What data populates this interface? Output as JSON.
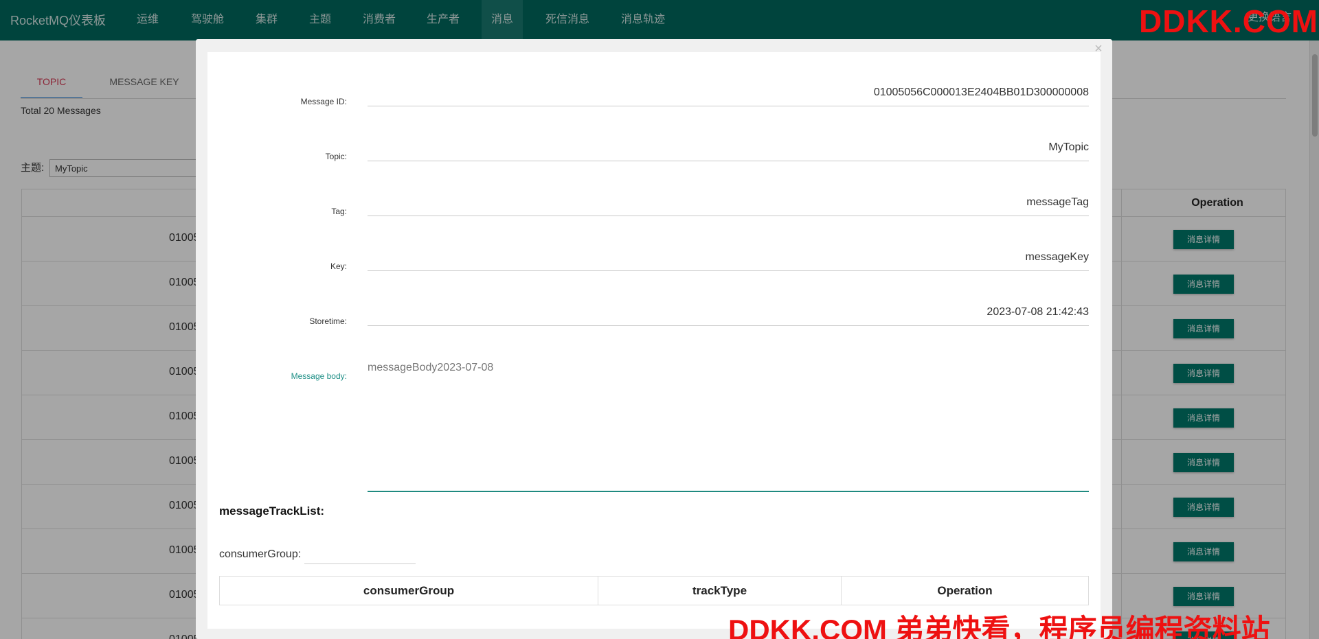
{
  "navbar": {
    "brand": "RocketMQ仪表板",
    "items": [
      "运维",
      "驾驶舱",
      "集群",
      "主题",
      "消费者",
      "生产者",
      "消息",
      "死信消息",
      "消息轨迹"
    ],
    "active_index": 6,
    "language": "更换语言"
  },
  "page": {
    "tabs": [
      "TOPIC",
      "MESSAGE KEY"
    ],
    "active_tab": "TOPIC",
    "total": "Total 20 Messages",
    "topic_label": "主题:",
    "topic_value": "MyTopic",
    "table": {
      "operation_header": "Operation",
      "row_id_prefix": "01005",
      "detail_button": "消息详情",
      "row_count": 10
    }
  },
  "modal": {
    "close_symbol": "×",
    "fields": [
      {
        "label": "Message ID:",
        "value": "01005056C000013E2404BB01D300000008"
      },
      {
        "label": "Topic:",
        "value": "MyTopic"
      },
      {
        "label": "Tag:",
        "value": "messageTag"
      },
      {
        "label": "Key:",
        "value": "messageKey"
      },
      {
        "label": "Storetime:",
        "value": "2023-07-08 21:42:43"
      }
    ],
    "body_label": "Message body:",
    "body_value": "messageBody2023-07-08",
    "track_title": "messageTrackList:",
    "consumer_group_label": "consumerGroup:",
    "consumer_group_value": "",
    "track_columns": [
      "consumerGroup",
      "trackType",
      "Operation"
    ]
  },
  "watermarks": {
    "top": "DDKK.COM",
    "bottom": "DDKK.COM 弟弟快看，程序员编程资料站"
  },
  "colors": {
    "navbar": "#00695f",
    "accent": "#00796b",
    "active_tab_text": "#d63a55",
    "watermark": "#ee1111"
  }
}
